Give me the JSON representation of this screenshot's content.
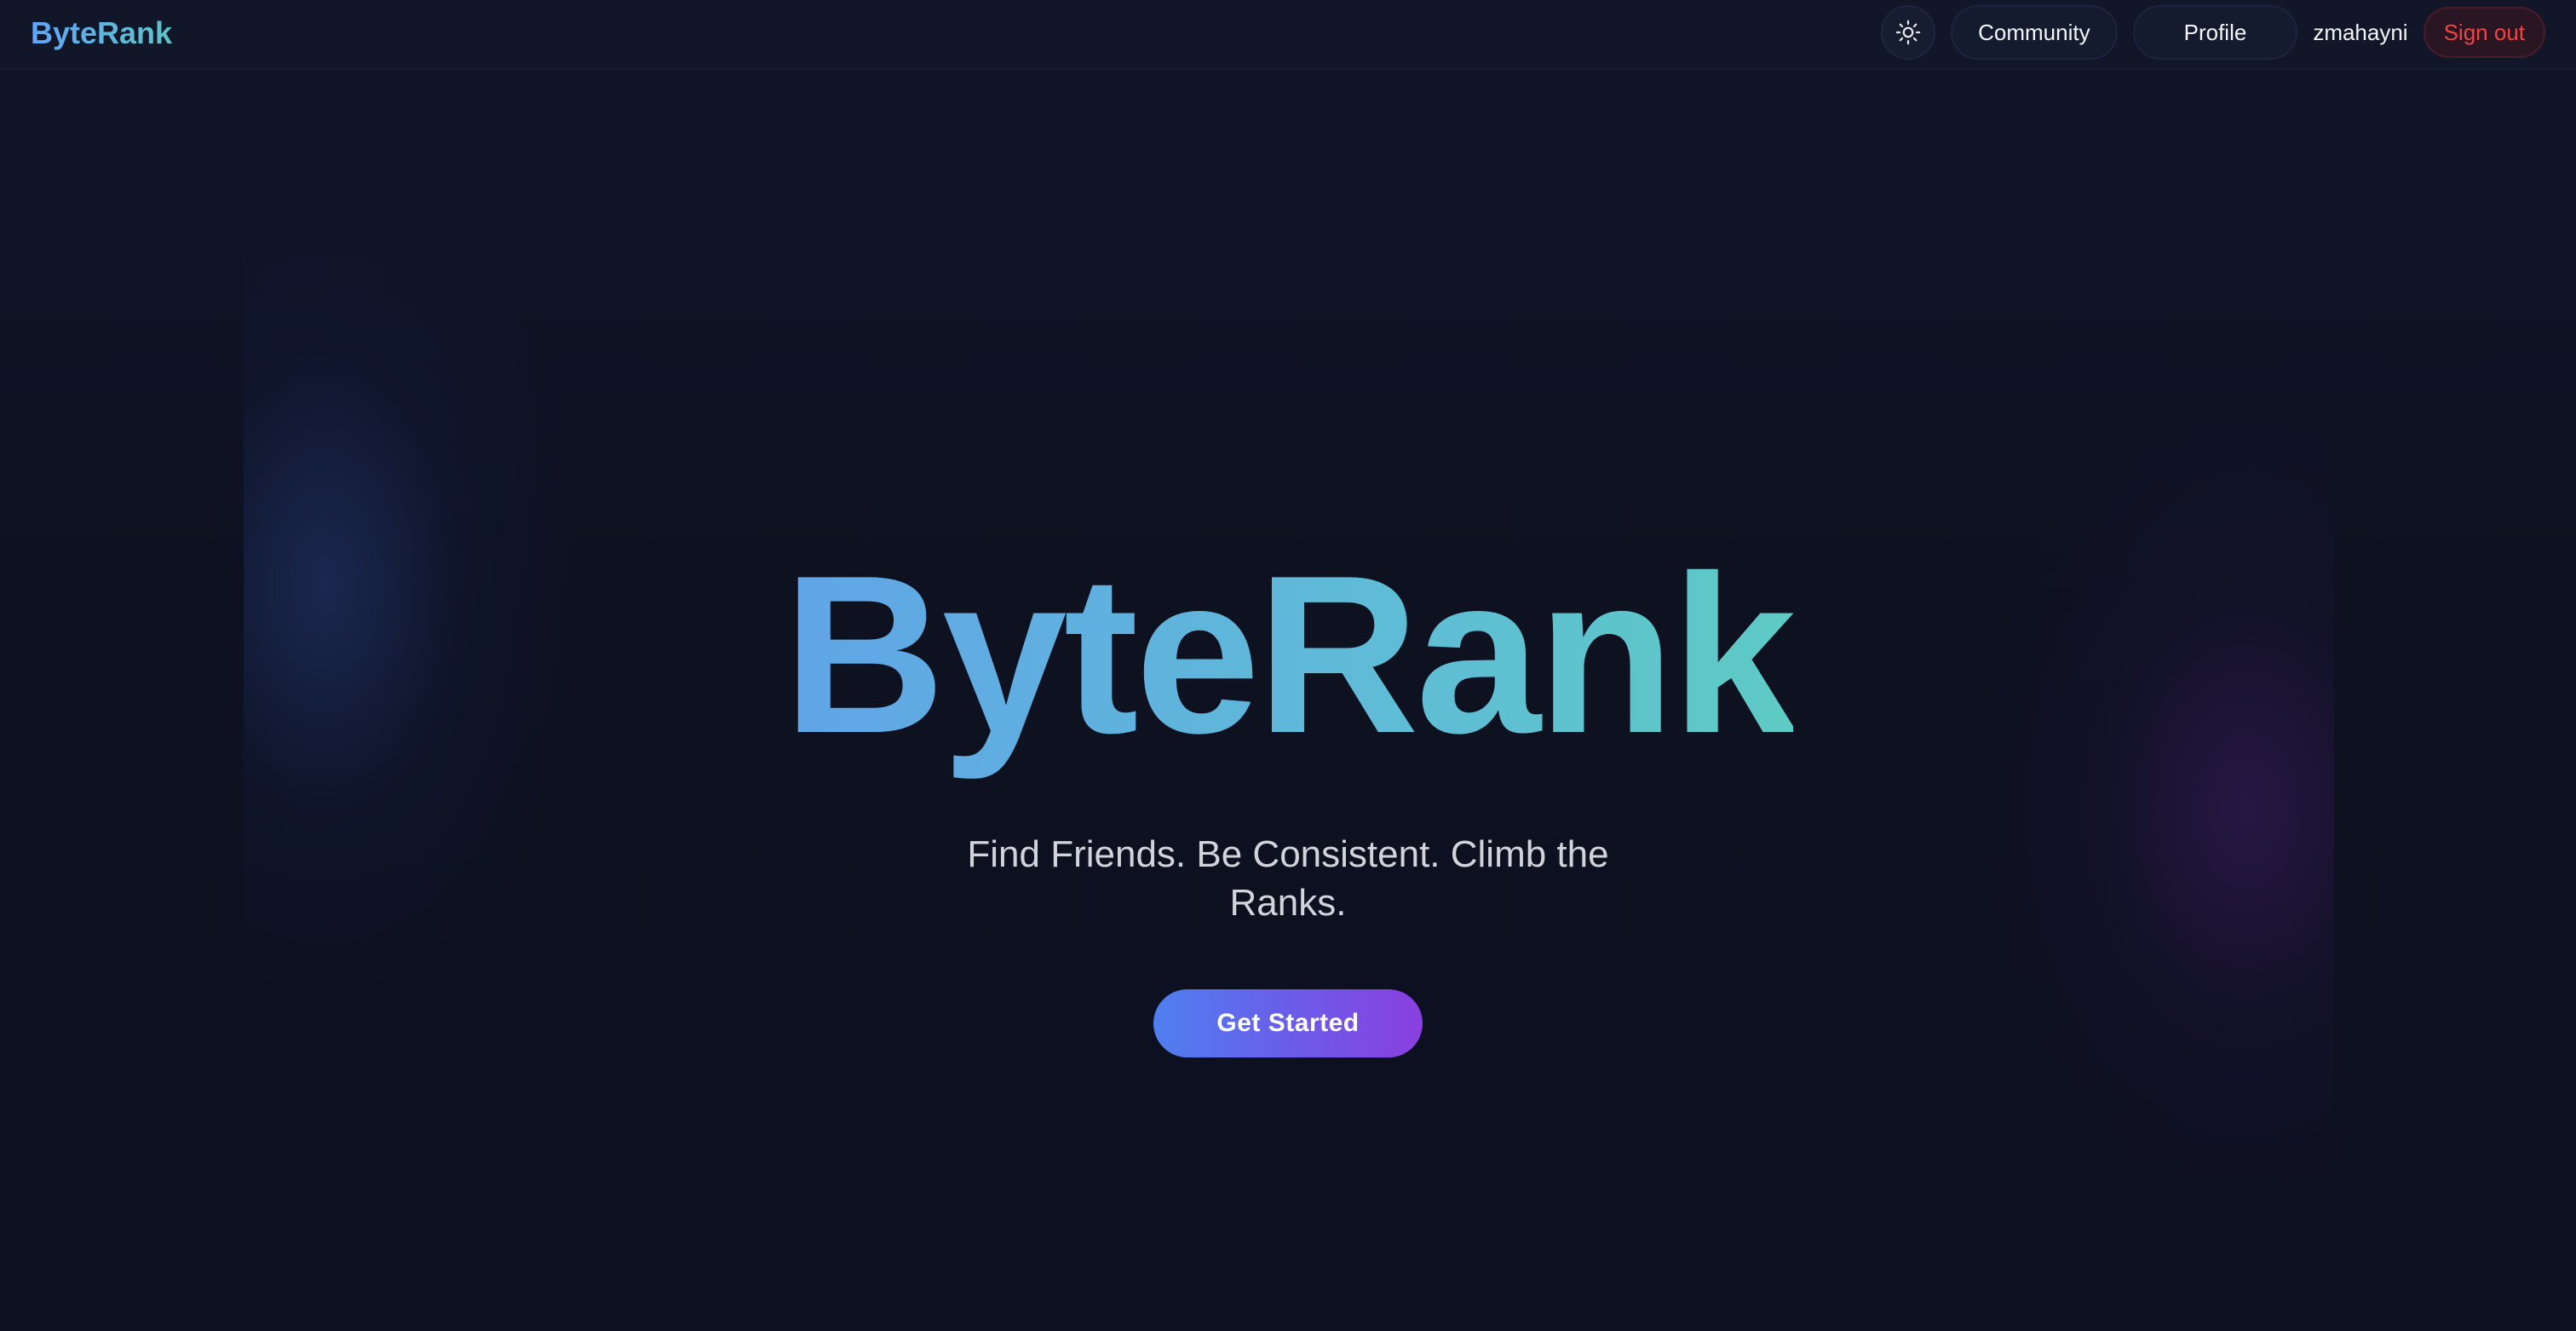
{
  "navbar": {
    "brand": "ByteRank",
    "theme_toggle_icon": "sun-icon",
    "community_label": "Community",
    "profile_label": "Profile",
    "username": "zmahayni",
    "signout_label": "Sign out"
  },
  "hero": {
    "title": "ByteRank",
    "tagline": "Find Friends. Be Consistent. Climb the Ranks.",
    "cta_label": "Get Started"
  },
  "colors": {
    "background": "#0d1120",
    "accent_blue": "#60a5fa",
    "accent_teal": "#5ecac4",
    "accent_purple": "#8a3fe0",
    "signout_red": "#ef4444"
  }
}
